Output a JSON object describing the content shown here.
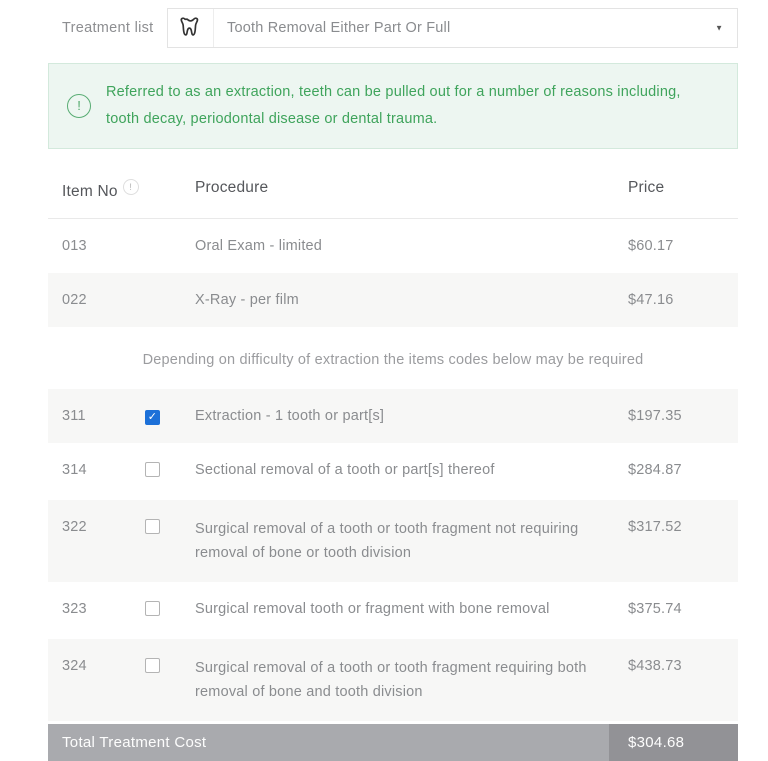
{
  "treatment_selector": {
    "label": "Treatment list",
    "selected_option": "Tooth Removal Either Part Or Full"
  },
  "info_box": {
    "text": "Referred to as an extraction, teeth can be pulled out for a number of reasons including, tooth decay, periodontal disease or dental trauma."
  },
  "table": {
    "headers": {
      "item_no": "Item No",
      "procedure": "Procedure",
      "price": "Price"
    },
    "base_rows": [
      {
        "item_no": "013",
        "procedure": "Oral Exam - limited",
        "price": "$60.17"
      },
      {
        "item_no": "022",
        "procedure": "X-Ray - per film",
        "price": "$47.16"
      }
    ],
    "note": "Depending on difficulty of extraction the items codes below may be required",
    "optional_rows": [
      {
        "item_no": "311",
        "procedure": "Extraction - 1 tooth or part[s]",
        "price": "$197.35",
        "checked": true
      },
      {
        "item_no": "314",
        "procedure": "Sectional removal of a tooth or part[s] thereof",
        "price": "$284.87",
        "checked": false
      },
      {
        "item_no": "322",
        "procedure": "Surgical removal of a tooth or tooth fragment not requiring removal of bone or tooth division",
        "price": "$317.52",
        "checked": false
      },
      {
        "item_no": "323",
        "procedure": "Surgical removal tooth or fragment with bone removal",
        "price": "$375.74",
        "checked": false
      },
      {
        "item_no": "324",
        "procedure": "Surgical removal of a tooth or tooth fragment requiring both removal of bone and tooth division",
        "price": "$438.73",
        "checked": false
      }
    ],
    "total": {
      "label": "Total Treatment Cost",
      "value": "$304.68"
    }
  },
  "colors": {
    "accent_green": "#3fa45c",
    "info_bg": "#edf6f1",
    "checkbox_checked": "#1c70d8",
    "row_shaded": "#f7f7f6",
    "total_bar": "#a9aaae",
    "total_value_bg": "#929296"
  }
}
